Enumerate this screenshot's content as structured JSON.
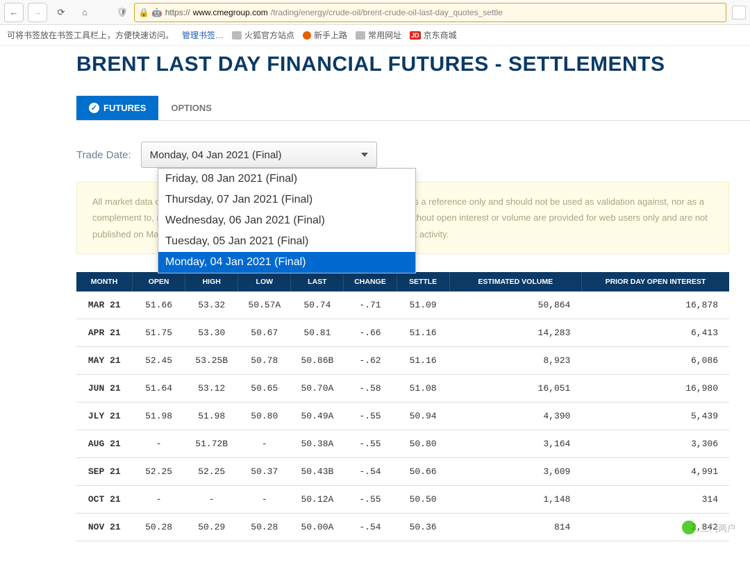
{
  "browser": {
    "url_prefix": "https://",
    "url_domain": "www.cmegroup.com",
    "url_path": "/trading/energy/crude-oil/brent-crude-oil-last-day_quotes_settle"
  },
  "bookmarks": {
    "hint": "可将书签放在书签工具栏上，方便快速访问。",
    "manage": "管理书签…",
    "items": [
      "火狐官方站点",
      "新手上路",
      "常用网址",
      "京东商城"
    ]
  },
  "page_title": "BRENT LAST DAY FINANCIAL FUTURES - SETTLEMENTS",
  "tabs": {
    "futures": "FUTURES",
    "options": "OPTIONS"
  },
  "trade_date": {
    "label": "Trade Date:",
    "selected": "Monday, 04 Jan 2021 (Final)",
    "options": [
      "Friday, 08 Jan 2021 (Final)",
      "Thursday, 07 Jan 2021 (Final)",
      "Wednesday, 06 Jan 2021 (Final)",
      "Tuesday, 05 Jan 2021 (Final)",
      "Monday, 04 Jan 2021 (Final)"
    ]
  },
  "disclaimer": "All market data contained within the CME Group website should be considered as a reference only and should not be used as validation against, nor as a complement to, real-time market data feeds. Settlement prices on instruments without open interest or volume are provided for web users only and are not published on Market Data Platform (MDP). These prices are not based on market activity.",
  "disclaimer_partial_lines": [
    "All market data",
    "ered as a reference only and should not be used as validation against,",
    "nor as a compl",
    "instruments without open interest or volume are provided for web",
    "users only and",
    "ces are not based on market activity."
  ],
  "table": {
    "headers": [
      "MONTH",
      "OPEN",
      "HIGH",
      "LOW",
      "LAST",
      "CHANGE",
      "SETTLE",
      "ESTIMATED VOLUME",
      "PRIOR DAY OPEN INTEREST"
    ],
    "rows": [
      {
        "month": "MAR 21",
        "open": "51.66",
        "high": "53.32",
        "low": "50.57A",
        "last": "50.74",
        "change": "-.71",
        "settle": "51.09",
        "est_vol": "50,864",
        "prior_oi": "16,878"
      },
      {
        "month": "APR 21",
        "open": "51.75",
        "high": "53.30",
        "low": "50.67",
        "last": "50.81",
        "change": "-.66",
        "settle": "51.16",
        "est_vol": "14,283",
        "prior_oi": "6,413"
      },
      {
        "month": "MAY 21",
        "open": "52.45",
        "high": "53.25B",
        "low": "50.78",
        "last": "50.86B",
        "change": "-.62",
        "settle": "51.16",
        "est_vol": "8,923",
        "prior_oi": "6,086"
      },
      {
        "month": "JUN 21",
        "open": "51.64",
        "high": "53.12",
        "low": "50.65",
        "last": "50.70A",
        "change": "-.58",
        "settle": "51.08",
        "est_vol": "16,051",
        "prior_oi": "16,980"
      },
      {
        "month": "JLY 21",
        "open": "51.98",
        "high": "51.98",
        "low": "50.80",
        "last": "50.49A",
        "change": "-.55",
        "settle": "50.94",
        "est_vol": "4,390",
        "prior_oi": "5,439"
      },
      {
        "month": "AUG 21",
        "open": "-",
        "high": "51.72B",
        "low": "-",
        "last": "50.38A",
        "change": "-.55",
        "settle": "50.80",
        "est_vol": "3,164",
        "prior_oi": "3,306"
      },
      {
        "month": "SEP 21",
        "open": "52.25",
        "high": "52.25",
        "low": "50.37",
        "last": "50.43B",
        "change": "-.54",
        "settle": "50.66",
        "est_vol": "3,609",
        "prior_oi": "4,991"
      },
      {
        "month": "OCT 21",
        "open": "-",
        "high": "-",
        "low": "-",
        "last": "50.12A",
        "change": "-.55",
        "settle": "50.50",
        "est_vol": "1,148",
        "prior_oi": "314"
      },
      {
        "month": "NOV 21",
        "open": "50.28",
        "high": "50.29",
        "low": "50.28",
        "last": "50.00A",
        "change": "-.54",
        "settle": "50.36",
        "est_vol": "814",
        "prior_oi": "2,842"
      }
    ]
  },
  "watermark": "三门两户"
}
